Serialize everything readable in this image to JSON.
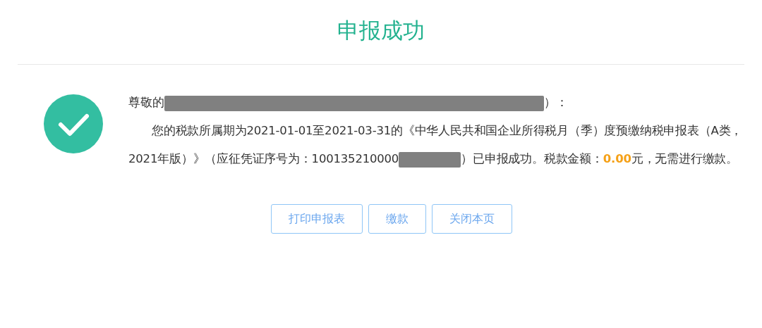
{
  "title": "申报成功",
  "greeting": {
    "before_redaction": "尊敬的",
    "after_redaction": "）："
  },
  "message": {
    "before_redaction": "您的税款所属期为2021-01-01至2021-03-31的《中华人民共和国企业所得税月（季）度预缴纳税申报表（A类，2021年版）》（应征凭证序号为：100135210000",
    "after_redaction": "）已申报成功。税款金额：**0.00**元，无需进行缴款。"
  },
  "buttons": [
    "打印申报表",
    "缴款",
    "关闭本页"
  ]
}
